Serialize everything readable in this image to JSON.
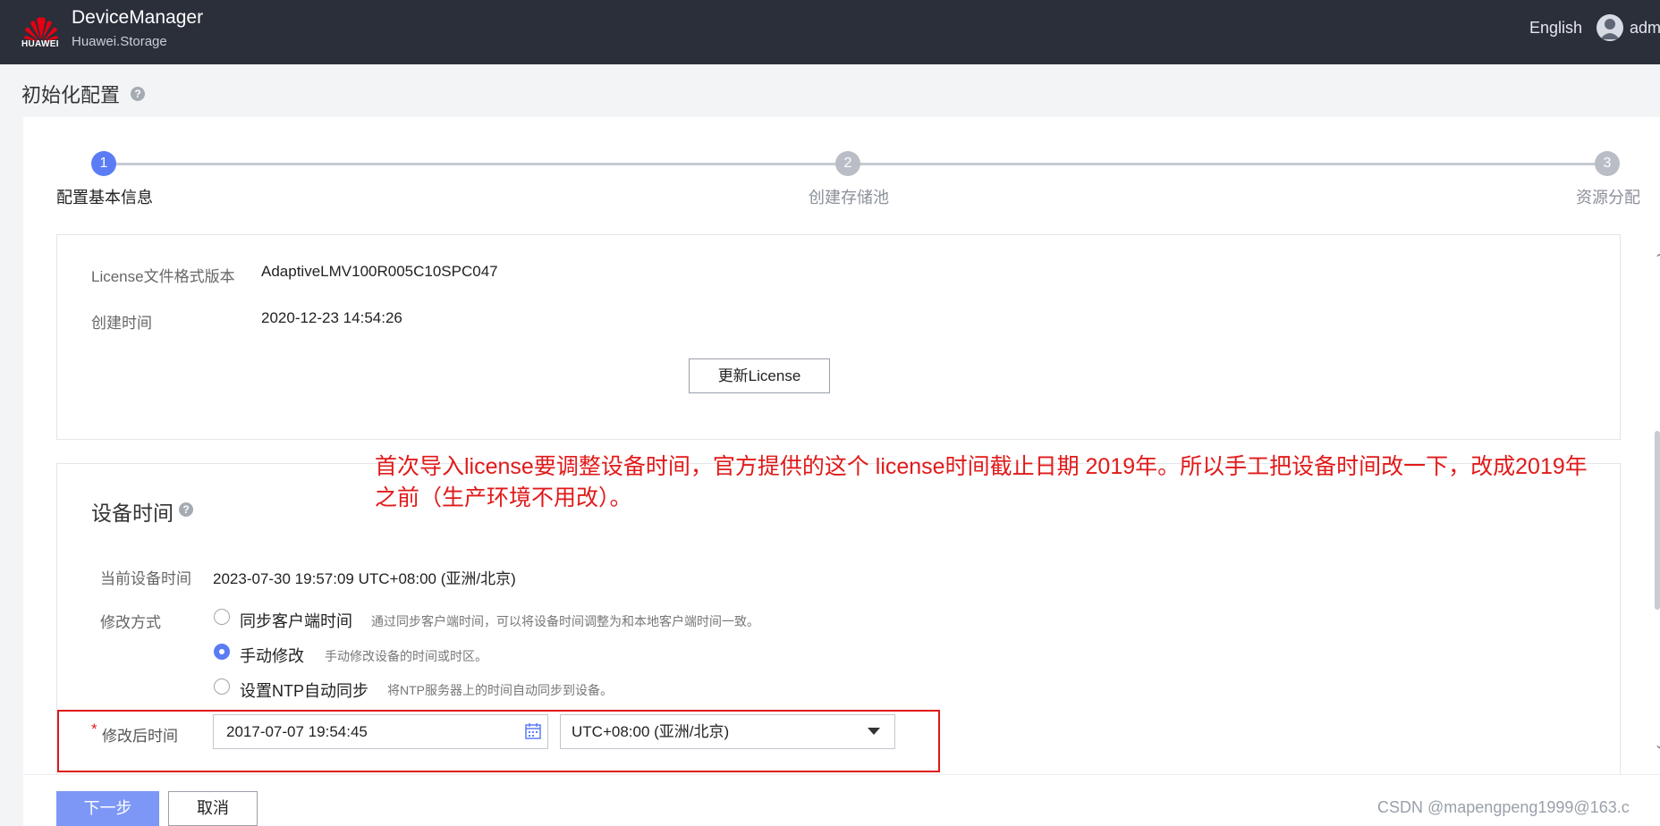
{
  "header": {
    "brand": "HUAWEI",
    "app_name": "DeviceManager",
    "app_sub": "Huawei.Storage",
    "language": "English",
    "user": "adm",
    "bg_color": "#2b2f3a"
  },
  "page": {
    "title": "初始化配置",
    "help": "?"
  },
  "steps": [
    {
      "num": "1",
      "label": "配置基本信息",
      "state": "active"
    },
    {
      "num": "2",
      "label": "创建存储池",
      "state": "pending"
    },
    {
      "num": "3",
      "label": "资源分配",
      "state": "pending"
    }
  ],
  "license": {
    "format_key": "License文件格式版本",
    "format_val": "AdaptiveLMV100R005C10SPC047",
    "created_key": "创建时间",
    "created_val": "2020-12-23 14:54:26",
    "update_button": "更新License"
  },
  "annotation": {
    "text": "首次导入license要调整设备时间，官方提供的这个 license时间截止日期 2019年。所以手工把设备时间改一下，改成2019年之前（生产环境不用改）。",
    "color": "#e11a1a"
  },
  "device_time": {
    "title": "设备时间",
    "help": "?",
    "current_key": "当前设备时间",
    "current_val": "2023-07-30 19:57:09 UTC+08:00 (亚洲/北京)",
    "mode_key": "修改方式",
    "options": [
      {
        "label": "同步客户端时间",
        "desc": "通过同步客户端时间，可以将设备时间调整为和本地客户端时间一致。",
        "checked": false
      },
      {
        "label": "手动修改",
        "desc": "手动修改设备的时间或时区。",
        "checked": true
      },
      {
        "label": "设置NTP自动同步",
        "desc": "将NTP服务器上的时间自动同步到设备。",
        "checked": false
      }
    ],
    "required_mark": "*",
    "new_time_key": "修改后时间",
    "new_time_value": "2017-07-07 19:54:45",
    "timezone_value": "UTC+08:00 (亚洲/北京)"
  },
  "footer": {
    "next": "下一步",
    "cancel": "取消",
    "watermark": "CSDN @mapengpeng1999@163.c"
  },
  "colors": {
    "accent": "#5b7cf5",
    "next_button": "#7d97f7",
    "highlight_frame": "#e01919"
  }
}
